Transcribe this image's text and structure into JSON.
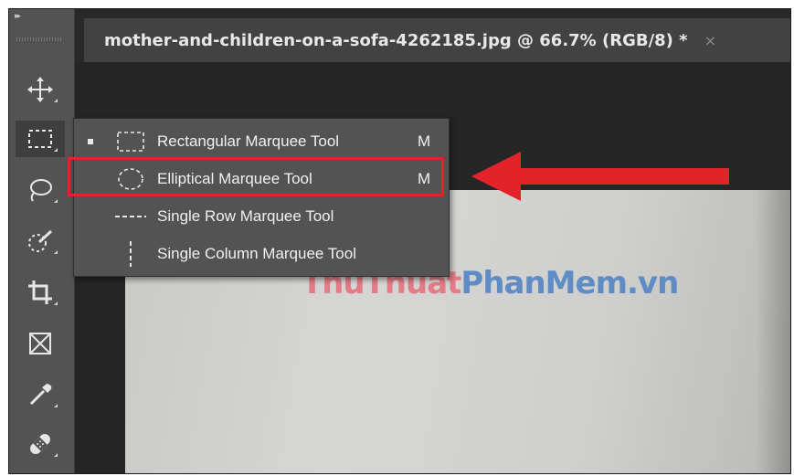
{
  "document": {
    "title": "mother-and-children-on-a-sofa-4262185.jpg @ 66.7% (RGB/8) *",
    "close_glyph": "×"
  },
  "toolbar": {
    "collapse_glyph": "▸▸",
    "tools": [
      {
        "name": "move-tool",
        "icon": "move-icon",
        "active": false
      },
      {
        "name": "marquee-tool",
        "icon": "rectangular-marquee-icon",
        "active": true
      },
      {
        "name": "lasso-tool",
        "icon": "lasso-icon",
        "active": false
      },
      {
        "name": "quick-selection-tool",
        "icon": "quick-selection-icon",
        "active": false
      },
      {
        "name": "crop-tool",
        "icon": "crop-icon",
        "active": false
      },
      {
        "name": "frame-tool",
        "icon": "frame-icon",
        "active": false
      },
      {
        "name": "eyedropper-tool",
        "icon": "eyedropper-icon",
        "active": false
      },
      {
        "name": "healing-brush-tool",
        "icon": "bandage-icon",
        "active": false
      }
    ]
  },
  "flyout": {
    "items": [
      {
        "label": "Rectangular Marquee Tool",
        "shortcut": "M",
        "icon": "rectangular-marquee-icon",
        "selected": true
      },
      {
        "label": "Elliptical Marquee Tool",
        "shortcut": "M",
        "icon": "elliptical-marquee-icon",
        "selected": false
      },
      {
        "label": "Single Row Marquee Tool",
        "shortcut": "",
        "icon": "single-row-marquee-icon",
        "selected": false
      },
      {
        "label": "Single Column Marquee Tool",
        "shortcut": "",
        "icon": "single-column-marquee-icon",
        "selected": false
      }
    ],
    "highlighted_index": 1
  },
  "watermark": {
    "part1": "ThuThuat",
    "part2": "PhanMem.vn"
  },
  "colors": {
    "highlight": "#e2242a",
    "arrow": "#e2242a",
    "menu_bg": "#535353",
    "toolbar_bg": "#535353",
    "watermark_red": "#e37c86",
    "watermark_blue": "#5f8cc4"
  }
}
